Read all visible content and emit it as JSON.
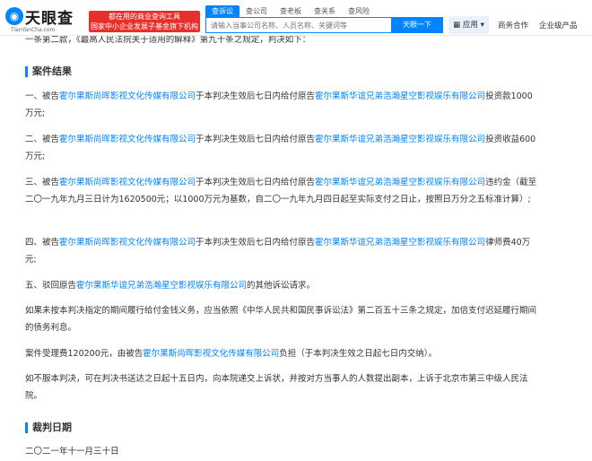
{
  "header": {
    "logo_text": "天眼查",
    "logo_domain": "TianYanCha.com",
    "slogan_line1": "都在用的商业查询工具",
    "slogan_line2": "国家中小企业发展子基金旗下机构",
    "search_tabs": [
      "查诉讼",
      "查公司",
      "查老板",
      "查关系",
      "查风险"
    ],
    "search_placeholder": "请输入当事公司名称、人员名称、关键词等",
    "search_button": "天眼一下",
    "apps_label": "应用",
    "business_label": "商务合作",
    "enterprise_label": "企业级产品"
  },
  "document": {
    "intro_partial": "一条第二款，《最高人民法院关于适用的解释》第九十条之规定，判决如下：",
    "result_title": "案件结果",
    "defendant": "霍尔果斯尚晖影视文化传媒有限公司",
    "plaintiff": "霍尔果斯华谊兄弟浩瀚星空影视娱乐有限公司",
    "item1_prefix": "一、被告",
    "item1_mid": "于本判决生效后七日内给付原告",
    "item1_suffix": "投资款1000万元;",
    "item2_prefix": "二、被告",
    "item2_mid": "于本判决生效后七日内给付原告",
    "item2_suffix": "投资收益600万元;",
    "item3_prefix": "三、被告",
    "item3_mid": "于本判决生效后七日内给付原告",
    "item3_suffix": "违约金（截至二〇一九年九月三日计为1620500元；以1000万元为基数，自二〇一九年九月四日起至实际支付之日止，按照日万分之五标准计算）;",
    "item4_prefix": "四、被告",
    "item4_mid": "于本判决生效后七日内给付原告",
    "item4_suffix": "律师费40万元;",
    "item5_prefix": "五、驳回原告",
    "item5_suffix": "的其他诉讼请求。",
    "para_interest": "如果未按本判决指定的期间履行给付金钱义务，应当依照《中华人民共和国民事诉讼法》第二百五十三条之规定，加倍支付迟延履行期间的债务利息。",
    "fee_prefix": "案件受理费120200元，由被告",
    "fee_suffix": "负担（于本判决生效之日起七日内交纳）。",
    "para_appeal": "如不服本判决，可在判决书送达之日起十五日内，向本院递交上诉状，并按对方当事人的人数提出副本，上诉于北京市第三中级人民法院。",
    "date_title": "裁判日期",
    "date_value": "二〇二一年十一月三十日"
  }
}
